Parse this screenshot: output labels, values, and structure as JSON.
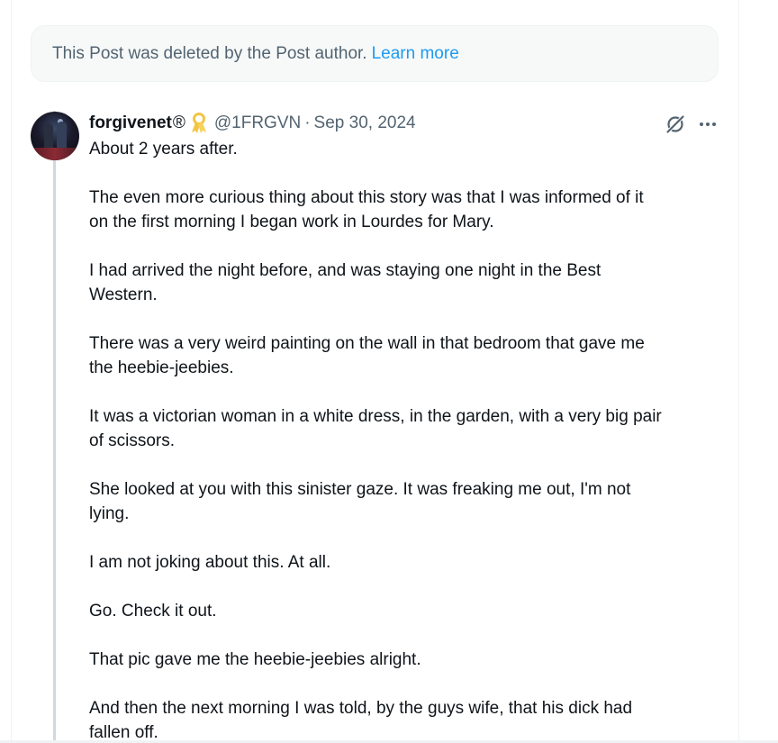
{
  "deleted_notice": {
    "text": "This Post was deleted by the Post author.",
    "link": "Learn more"
  },
  "post": {
    "display_name": "forgivenet",
    "registered_mark": "®",
    "badge_icon": "yellow-ribbon-icon",
    "handle": "@1FRGVN",
    "separator": "·",
    "timestamp": "Sep 30, 2024",
    "paragraphs": [
      "About 2 years after.",
      "The even more curious thing about this story was that I was informed of it\non the first morning I began work in Lourdes for Mary.",
      "I had arrived the night before, and was staying one night in the Best\nWestern.",
      "There was a very weird painting on the wall in that bedroom that gave me\nthe heebie-jeebies.",
      "It was a victorian woman in a white dress, in the garden, with a very big pair\nof scissors.",
      "She looked at you with this sinister gaze. It was freaking me out, I'm not\nlying.",
      "I am not joking about this. At all.",
      "Go. Check it out.",
      "That pic gave me the heebie-jeebies alright.",
      "And then the next morning I was told, by the guys wife, that his dick had\nfallen off."
    ]
  },
  "icons": {
    "grok": "grok-icon",
    "more": "more-icon"
  },
  "colors": {
    "link": "#1d9bf0",
    "muted_text": "#536471",
    "primary_text": "#0f1419",
    "notice_bg": "#f7f9f9",
    "thread_line": "#cfd9de",
    "ribbon": "#f4c542"
  }
}
